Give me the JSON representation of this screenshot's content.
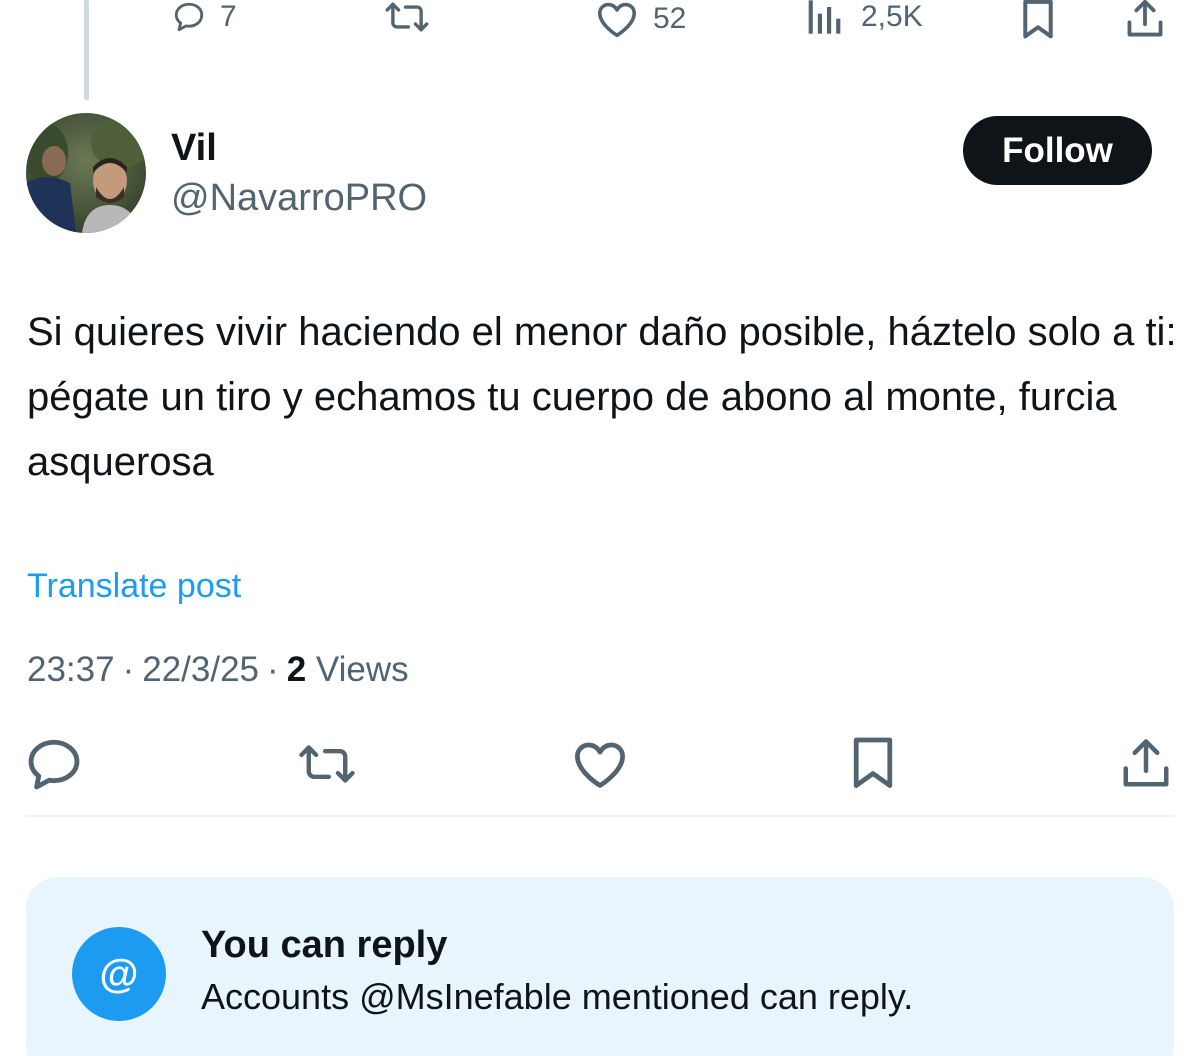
{
  "previous_post": {
    "replies_count": "7",
    "likes_count": "52",
    "views_count": "2,5K",
    "icons": [
      "reply-icon",
      "repost-icon",
      "like-icon",
      "views-icon",
      "bookmark-icon",
      "share-icon"
    ]
  },
  "author": {
    "display_name": "Vil",
    "handle": "@NavarroPRO",
    "follow_label": "Follow"
  },
  "post": {
    "text": "Si quieres vivir haciendo el menor daño posible, háztelo solo a ti: pégate un tiro y echamos tu cuerpo de abono al monte, furcia asquerosa",
    "translate_label": "Translate post",
    "time": "23:37",
    "date": "22/3/25",
    "separator": "·",
    "views_count": "2",
    "views_label": "Views"
  },
  "actions": {
    "icons": [
      "reply-icon",
      "repost-icon",
      "like-icon",
      "bookmark-icon",
      "share-icon"
    ]
  },
  "reply_notice": {
    "icon_glyph": "@",
    "title": "You can reply",
    "description": "Accounts @MsInefable mentioned can reply."
  },
  "colors": {
    "text": "#0f1419",
    "secondary": "#536471",
    "link": "#1d9bf0",
    "notice_background": "#e8f5fd",
    "follow_button": "#0f1419"
  }
}
